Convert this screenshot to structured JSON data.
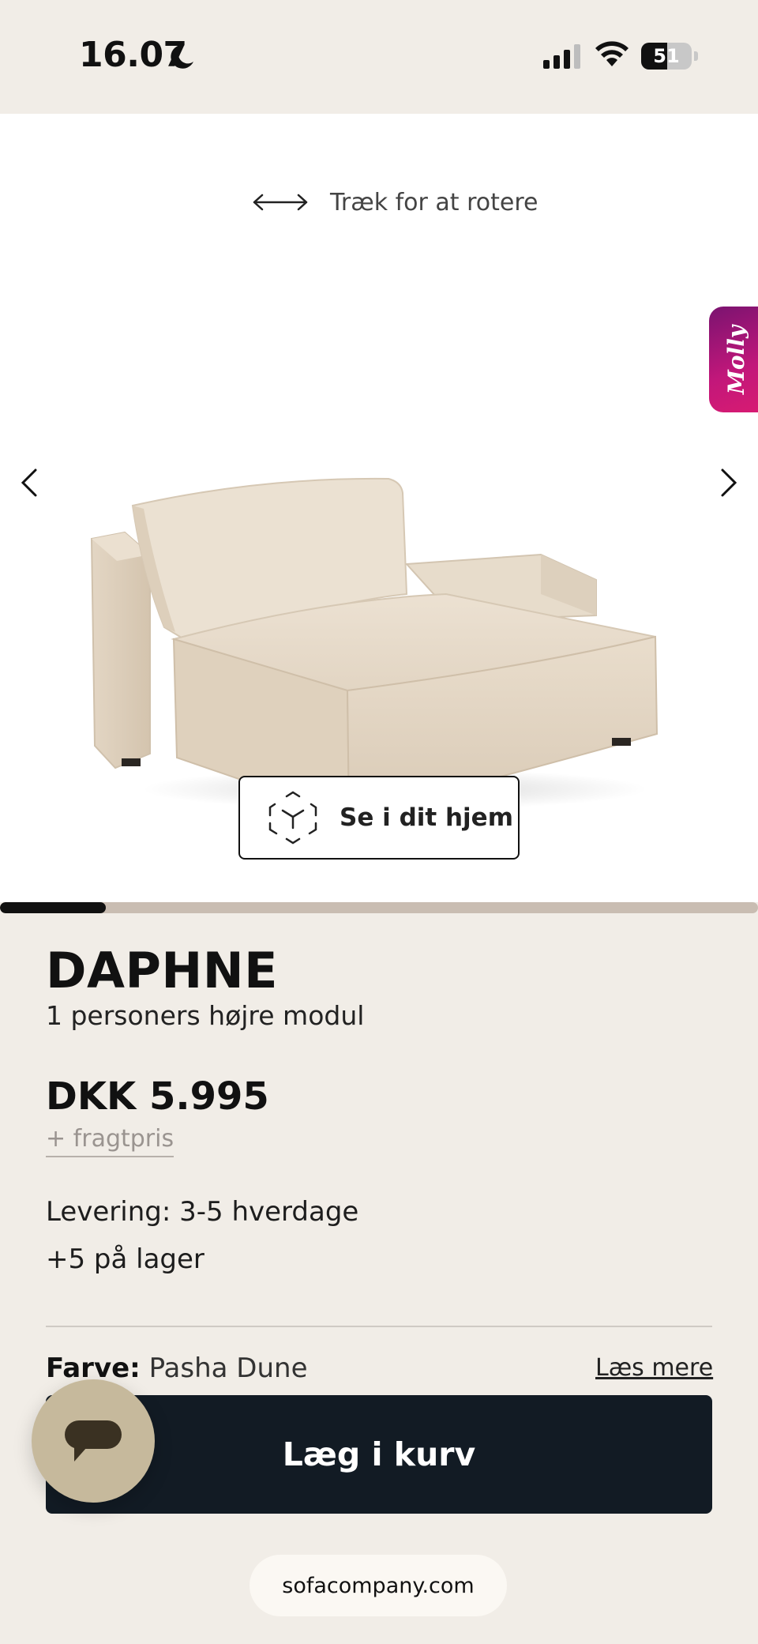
{
  "status_bar": {
    "time": "16.07",
    "battery_percent": 51,
    "battery_text": "51"
  },
  "gallery": {
    "rotate_hint": "Træk for at rotere",
    "ar_button_label": "Se i dit hjem",
    "badge_label": "Molly",
    "image_progress": 0.14,
    "icons": [
      "double-arrow-icon",
      "chevron-left-icon",
      "chevron-right-icon",
      "ar-cube-icon",
      "moon-icon",
      "signal-icon",
      "wifi-icon",
      "chat-bubble-icon"
    ]
  },
  "product": {
    "name": "DAPHNE",
    "subtitle": "1 personers højre modul",
    "price": "DKK 5.995",
    "freight": "+ fragtpris",
    "delivery": "Levering: 3-5 hverdage",
    "stock": "+5 på lager",
    "color_label": "Farve:",
    "color_value": "Pasha Dune",
    "read_more": "Læs mere",
    "add_to_cart": "Læg i kurv"
  },
  "browser": {
    "url": "sofacompany.com"
  },
  "colors": {
    "page_bg": "#f1ede7",
    "cart_button_bg": "#121b24",
    "chat_button_bg": "#c6b99c",
    "badge_gradient_start": "#7a1370",
    "badge_gradient_end": "#d81b72"
  }
}
